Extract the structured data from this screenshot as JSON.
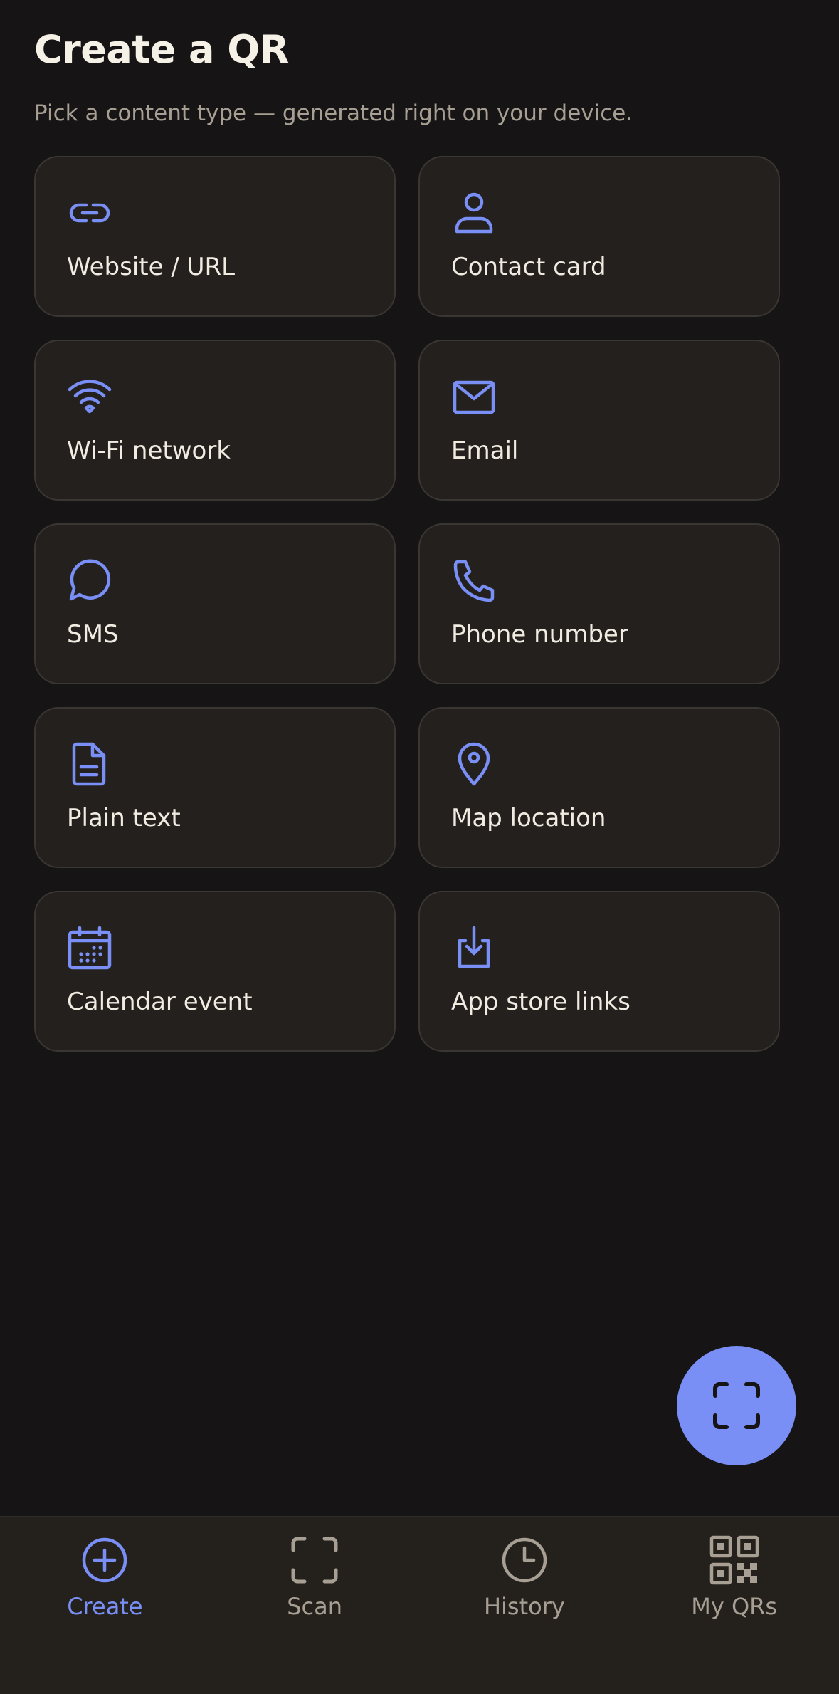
{
  "header": {
    "title": "Create a QR",
    "subtitle": "Pick a content type — generated right on your device."
  },
  "content_types": [
    {
      "label": "Website / URL",
      "icon": "link-icon"
    },
    {
      "label": "Contact card",
      "icon": "person-icon"
    },
    {
      "label": "Wi-Fi network",
      "icon": "wifi-icon"
    },
    {
      "label": "Email",
      "icon": "mail-icon"
    },
    {
      "label": "SMS",
      "icon": "chat-bubble-icon"
    },
    {
      "label": "Phone number",
      "icon": "phone-icon"
    },
    {
      "label": "Plain text",
      "icon": "document-icon"
    },
    {
      "label": "Map location",
      "icon": "map-pin-icon"
    },
    {
      "label": "Calendar event",
      "icon": "calendar-icon"
    },
    {
      "label": "App store links",
      "icon": "download-icon"
    }
  ],
  "fab": {
    "icon": "scan-frame-icon"
  },
  "bottom_nav": {
    "items": [
      {
        "label": "Create",
        "icon": "plus-circle-icon",
        "active": true
      },
      {
        "label": "Scan",
        "icon": "scan-frame-icon",
        "active": false
      },
      {
        "label": "History",
        "icon": "clock-icon",
        "active": false
      },
      {
        "label": "My QRs",
        "icon": "qr-code-icon",
        "active": false
      }
    ]
  },
  "colors": {
    "background": "#161414",
    "card": "#23201d",
    "card_border": "#3a3631",
    "accent": "#7a8ff5",
    "text": "#f1ece1",
    "muted": "#a79f93",
    "nav_background": "#24211d"
  }
}
